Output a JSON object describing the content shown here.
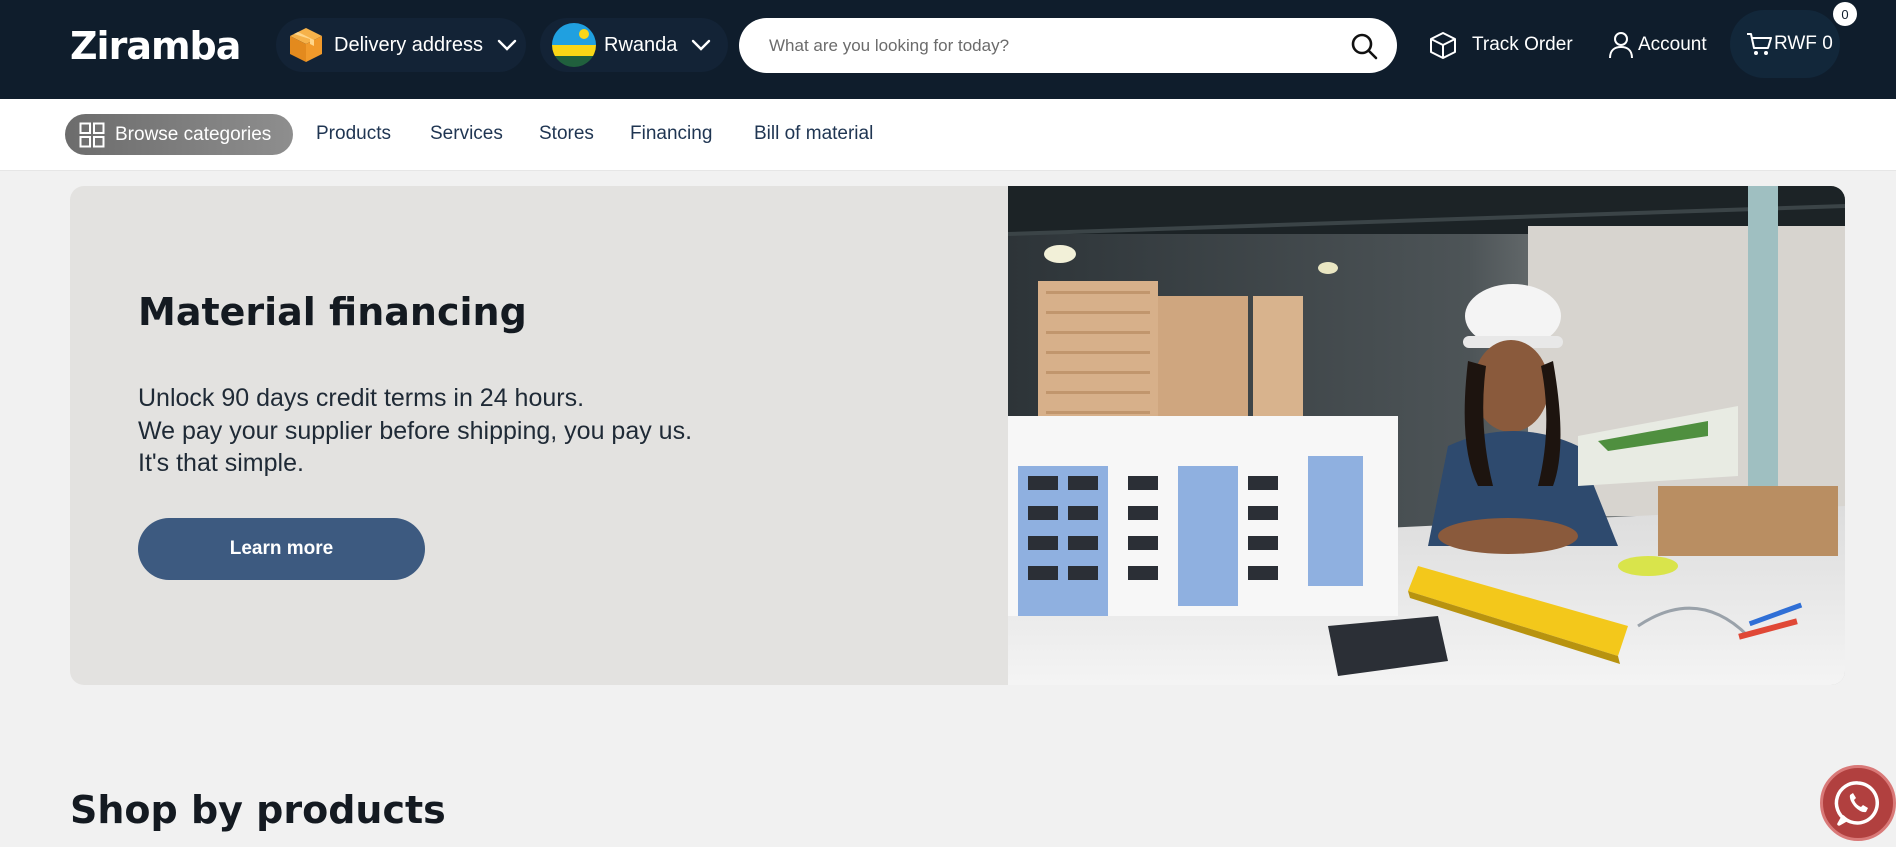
{
  "header": {
    "logo_text": "Ziramba",
    "delivery_label": "Delivery address",
    "country_label": "Rwanda",
    "search_placeholder": "What are you looking for today?",
    "track_order_label": "Track Order",
    "account_label": "Account",
    "cart_label": "RWF 0",
    "cart_count": "0",
    "colors": {
      "background": "#0f1d2c",
      "text": "#ffffff"
    },
    "icons": [
      "package-icon",
      "rwanda-flag-icon",
      "chevron-down-icon",
      "search-icon",
      "cube-icon",
      "user-icon",
      "cart-icon"
    ]
  },
  "subnav": {
    "browse_label": "Browse categories",
    "links": [
      "Products",
      "Services",
      "Stores",
      "Financing",
      "Bill of material"
    ]
  },
  "hero": {
    "title": "Material financing",
    "lines": [
      "Unlock 90 days credit terms in 24 hours.",
      "We pay your supplier before shipping, you pay us.",
      "It's that simple."
    ],
    "button_label": "Learn more",
    "button_color": "#3d5a80"
  },
  "sections": {
    "shop_by_products_title": "Shop by products"
  },
  "floating": {
    "whatsapp_icon": "whatsapp-icon",
    "color": "#b1403f"
  }
}
